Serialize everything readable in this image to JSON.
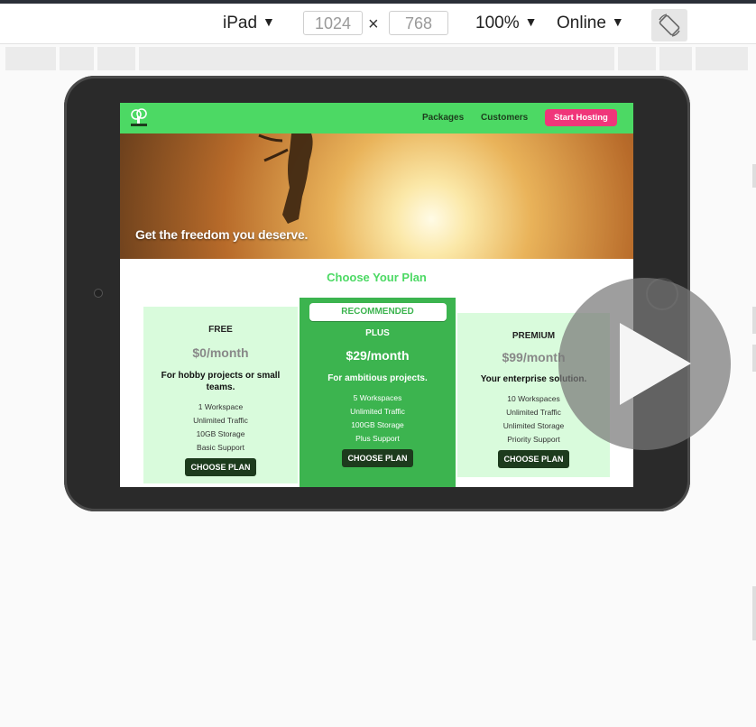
{
  "toolbar": {
    "device": "iPad",
    "width": "1024",
    "times": "×",
    "height": "768",
    "zoom": "100%",
    "network": "Online"
  },
  "site": {
    "nav": {
      "packages": "Packages",
      "customers": "Customers",
      "cta": "Start Hosting"
    },
    "hero_text": "Get the freedom you deserve.",
    "section_title": "Choose Your Plan",
    "plans": [
      {
        "name": "FREE",
        "price": "$0/month",
        "desc": "For hobby projects or small teams.",
        "features": [
          "1 Workspace",
          "Unlimited Traffic",
          "10GB Storage",
          "Basic Support"
        ],
        "button": "CHOOSE PLAN"
      },
      {
        "badge": "RECOMMENDED",
        "name": "PLUS",
        "price": "$29/month",
        "desc": "For ambitious projects.",
        "features": [
          "5 Workspaces",
          "Unlimited Traffic",
          "100GB Storage",
          "Plus Support"
        ],
        "button": "CHOOSE PLAN"
      },
      {
        "name": "PREMIUM",
        "price": "$99/month",
        "desc": "Your enterprise solution.",
        "features": [
          "10 Workspaces",
          "Unlimited Traffic",
          "Unlimited Storage",
          "Priority Support"
        ],
        "button": "CHOOSE PLAN"
      }
    ]
  },
  "colors": {
    "nav_green": "#4cd964",
    "cta_pink": "#f0367a",
    "plus_green": "#3cb44f",
    "card_light": "#d9fbdc",
    "button_dark": "#1d3b1d"
  },
  "icons": {
    "caret": "caret-down-icon",
    "rotate": "rotate-device-icon",
    "play": "play-icon",
    "logo": "tree-logo-icon"
  }
}
